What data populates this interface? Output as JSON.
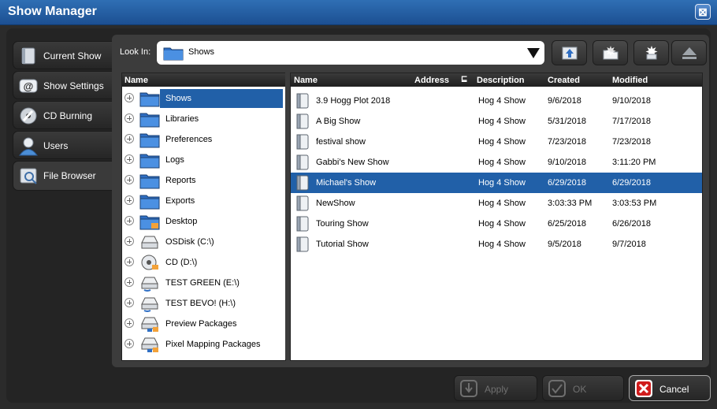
{
  "window": {
    "title": "Show Manager",
    "close_glyph": "⊠"
  },
  "nav": {
    "items": [
      {
        "label": "Current Show",
        "icon": "show-book-icon"
      },
      {
        "label": "Show Settings",
        "icon": "settings-at-icon"
      },
      {
        "label": "CD Burning",
        "icon": "cd-burn-icon"
      },
      {
        "label": "Users",
        "icon": "user-icon"
      },
      {
        "label": "File Browser",
        "icon": "file-browser-icon",
        "active": true
      }
    ]
  },
  "lookin": {
    "label": "Look In:",
    "value": "Shows"
  },
  "toolbar": {
    "buttons": [
      "up-folder-icon",
      "new-folder-icon",
      "burst-icon",
      "eject-icon"
    ]
  },
  "tree": {
    "header": "Name",
    "items": [
      {
        "label": "Shows",
        "icon": "folder-icon",
        "selected": true
      },
      {
        "label": "Libraries",
        "icon": "folder-icon"
      },
      {
        "label": "Preferences",
        "icon": "folder-icon"
      },
      {
        "label": "Logs",
        "icon": "folder-icon"
      },
      {
        "label": "Reports",
        "icon": "folder-icon"
      },
      {
        "label": "Exports",
        "icon": "folder-icon"
      },
      {
        "label": "Desktop",
        "icon": "desktop-folder-icon"
      },
      {
        "label": "OSDisk (C:\\)",
        "icon": "hard-drive-icon"
      },
      {
        "label": "CD (D:\\)",
        "icon": "cd-drive-icon"
      },
      {
        "label": "TEST GREEN (E:\\)",
        "icon": "usb-drive-icon"
      },
      {
        "label": "TEST BEVO! (H:\\)",
        "icon": "usb-drive-icon"
      },
      {
        "label": "Preview Packages",
        "icon": "network-drive-icon"
      },
      {
        "label": "Pixel Mapping Packages",
        "icon": "network-drive-icon"
      }
    ]
  },
  "list": {
    "columns": [
      "Name",
      "Address",
      "Description",
      "Created",
      "Modified"
    ],
    "rows": [
      {
        "name": "3.9 Hogg Plot 2018",
        "description": "Hog 4 Show",
        "created": "9/6/2018",
        "modified": "9/10/2018"
      },
      {
        "name": "A Big Show",
        "description": "Hog 4 Show",
        "created": "5/31/2018",
        "modified": "7/17/2018"
      },
      {
        "name": "festival show",
        "description": "Hog 4 Show",
        "created": "7/23/2018",
        "modified": "7/23/2018"
      },
      {
        "name": "Gabbi's New Show",
        "description": "Hog 4 Show",
        "created": "9/10/2018",
        "modified": "3:11:20 PM"
      },
      {
        "name": "Michael's Show",
        "description": "Hog 4 Show",
        "created": "6/29/2018",
        "modified": "6/29/2018",
        "selected": true
      },
      {
        "name": "NewShow",
        "description": "Hog 4 Show",
        "created": "3:03:33 PM",
        "modified": "3:03:53 PM"
      },
      {
        "name": "Touring Show",
        "description": "Hog 4 Show",
        "created": "6/25/2018",
        "modified": "6/26/2018"
      },
      {
        "name": "Tutorial Show",
        "description": "Hog 4 Show",
        "created": "9/5/2018",
        "modified": "9/7/2018"
      }
    ]
  },
  "footer": {
    "apply": "Apply",
    "ok": "OK",
    "cancel": "Cancel"
  },
  "colors": {
    "titlebar": "#1c4f92",
    "selection": "#2160a8",
    "cancel_red": "#d01c1c"
  }
}
